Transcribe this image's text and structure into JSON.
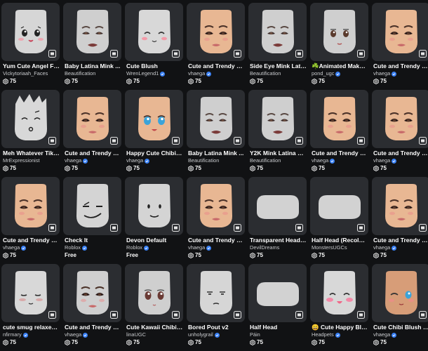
{
  "items": [
    {
      "name": "Yum Cute Angel Fa...",
      "creator": "Vickytoriaah_Faces",
      "verified": false,
      "price": "75",
      "face": "angel"
    },
    {
      "name": "Baby Latina Mink ...",
      "creator": "Beautification",
      "verified": false,
      "price": "75",
      "face": "latina-gray"
    },
    {
      "name": "Cute Blush",
      "creator": "WrenLegend1",
      "verified": true,
      "price": "75",
      "face": "blush"
    },
    {
      "name": "Cute and Trendy Pr...",
      "creator": "vhaega",
      "verified": true,
      "price": "75",
      "face": "trendy"
    },
    {
      "name": "Side Eye Mink Latin...",
      "creator": "Beautification",
      "verified": false,
      "price": "75",
      "face": "latina-gray"
    },
    {
      "name": "☘️Animated Makeu...",
      "creator": "pond_ugc",
      "verified": true,
      "price": "75",
      "face": "anime-gray"
    },
    {
      "name": "Cute and Trendy Pr...",
      "creator": "vhaega",
      "verified": true,
      "price": "75",
      "face": "trendy"
    },
    {
      "name": "Meh Whatever TikT...",
      "creator": "MrExpressionist",
      "verified": false,
      "price": "75",
      "face": "meh"
    },
    {
      "name": "Cute and Trendy Pr...",
      "creator": "vhaega",
      "verified": true,
      "price": "75",
      "face": "trendy"
    },
    {
      "name": "Happy Cute Chibi B...",
      "creator": "vhaega",
      "verified": true,
      "price": "75",
      "face": "chibi-happy"
    },
    {
      "name": "Baby Latina Mink ...",
      "creator": "Beautification",
      "verified": false,
      "price": "75",
      "face": "latina-gray"
    },
    {
      "name": "Y2K Mink Latina M...",
      "creator": "Beautification",
      "verified": false,
      "price": "75",
      "face": "latina-gray"
    },
    {
      "name": "Cute and Trendy Pr...",
      "creator": "vhaega",
      "verified": true,
      "price": "75",
      "face": "trendy"
    },
    {
      "name": "Cute and Trendy Pr...",
      "creator": "vhaega",
      "verified": true,
      "price": "75",
      "face": "trendy"
    },
    {
      "name": "Cute and Trendy Pr...",
      "creator": "vhaega",
      "verified": true,
      "price": "75",
      "face": "trendy"
    },
    {
      "name": "Check It",
      "creator": "Roblox",
      "verified": true,
      "price": "Free",
      "face": "checkit"
    },
    {
      "name": "Devon Default",
      "creator": "Roblox",
      "verified": true,
      "price": "Free",
      "face": "default"
    },
    {
      "name": "Cute and Trendy Pr...",
      "creator": "vhaega",
      "verified": true,
      "price": "75",
      "face": "trendy"
    },
    {
      "name": "Transparent Head ...",
      "creator": "DevilDreams",
      "verified": false,
      "price": "75",
      "face": "flat"
    },
    {
      "name": "Half Head (Recolora...",
      "creator": "MonstersUGCs",
      "verified": false,
      "price": "75",
      "face": "flat"
    },
    {
      "name": "Cute and Trendy Pr...",
      "creator": "vhaega",
      "verified": true,
      "price": "75",
      "face": "trendy"
    },
    {
      "name": "cute smug relaxed ...",
      "creator": "nfirmary",
      "verified": true,
      "price": "75",
      "face": "smug"
    },
    {
      "name": "Cute and Trendy Pr...",
      "creator": "vhaega",
      "verified": true,
      "price": "75",
      "face": "trendy-gray"
    },
    {
      "name": "Cute Kawaii Chibi A...",
      "creator": "linaUGC",
      "verified": false,
      "price": "75",
      "face": "kawaii"
    },
    {
      "name": "Bored Pout v2",
      "creator": "unholygrail",
      "verified": true,
      "price": "75",
      "face": "bored"
    },
    {
      "name": "Half Head",
      "creator": "Páin",
      "verified": false,
      "price": "75",
      "face": "flat"
    },
    {
      "name": "😀 Cute Happy Blus...",
      "creator": "Headpets",
      "verified": true,
      "price": "75",
      "face": "happy-blush"
    },
    {
      "name": "Cute Chibi Blush Wi...",
      "creator": "vhaega",
      "verified": true,
      "price": "75",
      "face": "chibi-wink"
    }
  ],
  "colors": {
    "background": "#111214",
    "card": "#2b2d31",
    "verified": "#3b82f6",
    "gray_head": "#cfcfcf",
    "skin": "#e8b793"
  }
}
